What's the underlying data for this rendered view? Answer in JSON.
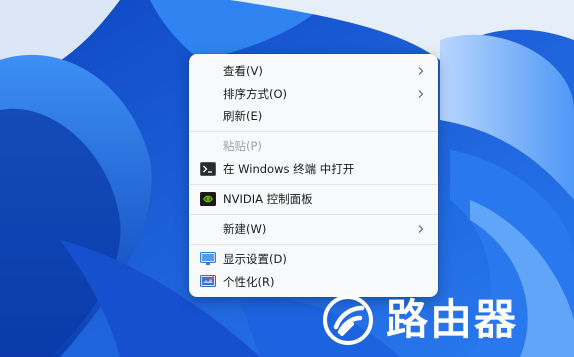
{
  "context_menu": {
    "items": [
      {
        "label": "查看(V)",
        "submenu": true
      },
      {
        "label": "排序方式(O)",
        "submenu": true
      },
      {
        "label": "刷新(E)"
      },
      {
        "label": "粘贴(P)",
        "disabled": true
      },
      {
        "label": "在 Windows 终端 中打开",
        "icon": "terminal-icon"
      },
      {
        "label": "NVIDIA 控制面板",
        "icon": "nvidia-icon"
      },
      {
        "label": "新建(W)",
        "submenu": true
      },
      {
        "label": "显示设置(D)",
        "icon": "display-settings-icon"
      },
      {
        "label": "个性化(R)",
        "icon": "personalize-icon"
      }
    ]
  },
  "watermark": {
    "text": "路由器"
  },
  "colors": {
    "wallpaper_blue": "#1a5fd6",
    "menu_background": "#f8f9fb",
    "disabled_text": "#a3a3a3",
    "nvidia_green": "#76b900"
  }
}
